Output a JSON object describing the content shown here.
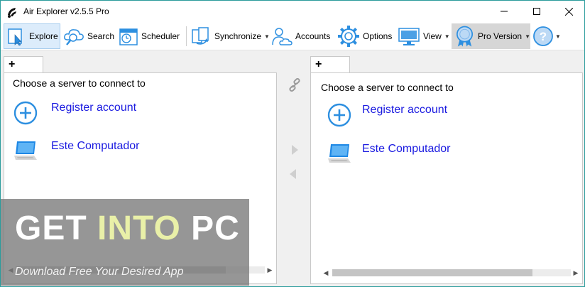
{
  "window": {
    "title": "Air Explorer v2.5.5 Pro",
    "controls": [
      "minimize",
      "maximize",
      "close"
    ]
  },
  "toolbar": {
    "items": [
      {
        "label": "Explore",
        "icon": "explore-icon",
        "state": "active"
      },
      {
        "label": "Search",
        "icon": "search-cloud-icon"
      },
      {
        "label": "Scheduler",
        "icon": "scheduler-calendar-icon"
      },
      {
        "label": "Synchronize",
        "icon": "synchronize-icon",
        "dropdown": true
      },
      {
        "label": "Accounts",
        "icon": "accounts-icon"
      },
      {
        "label": "Options",
        "icon": "options-gear-icon"
      },
      {
        "label": "View",
        "icon": "view-monitor-icon",
        "dropdown": true
      },
      {
        "label": "Pro Version",
        "icon": "pro-badge-icon",
        "dropdown": true,
        "state": "hover"
      },
      {
        "label": "",
        "icon": "help-icon",
        "dropdown": true
      }
    ]
  },
  "left_panel": {
    "tab_label": "+",
    "heading": "Choose a server to connect to",
    "entries": [
      {
        "label": "Register account",
        "icon": "add-circle-icon"
      },
      {
        "label": "Este Computador",
        "icon": "computer-icon"
      }
    ]
  },
  "right_panel": {
    "tab_label": "+",
    "heading": "Choose a server to connect to",
    "entries": [
      {
        "label": "Register account",
        "icon": "add-circle-icon"
      },
      {
        "label": "Este Computador",
        "icon": "computer-icon"
      }
    ]
  },
  "middle": {
    "icons": [
      "link-icon",
      "copy-right-arrow-icon",
      "copy-left-arrow-icon"
    ]
  },
  "watermark": {
    "word1": "GET ",
    "word2": "INTO",
    "word3": " PC",
    "tagline": "Download Free Your Desired App"
  },
  "colors": {
    "accent": "#2d8fe0",
    "link": "#1a1ae0",
    "border": "#2b9c9c"
  }
}
